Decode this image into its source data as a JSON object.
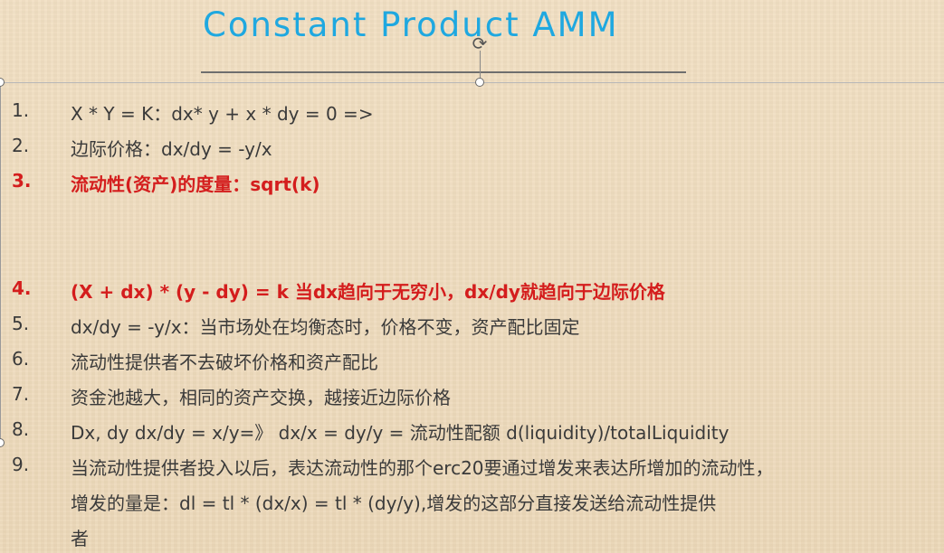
{
  "slide": {
    "title": "Constant Product AMM",
    "items": [
      {
        "num": "1.",
        "text": "X * Y = K：dx* y + x * dy = 0 =>",
        "highlight": false
      },
      {
        "num": "2.",
        "text": "边际价格：dx/dy = -y/x",
        "highlight": false
      },
      {
        "num": "3.",
        "text": "流动性(资产)的度量：sqrt(k)",
        "highlight": true
      },
      {
        "num": "4.",
        "text": "(X + dx) * (y - dy) = k 当dx趋向于无穷小，dx/dy就趋向于边际价格",
        "highlight": true
      },
      {
        "num": "5.",
        "text": "dx/dy = -y/x：当市场处在均衡态时，价格不变，资产配比固定",
        "highlight": false
      },
      {
        "num": "6.",
        "text": "流动性提供者不去破坏价格和资产配比",
        "highlight": false
      },
      {
        "num": "7.",
        "text": "资金池越大，相同的资产交换，越接近边际价格",
        "highlight": false
      },
      {
        "num": "8.",
        "text": "Dx, dy dx/dy = x/y=》 dx/x = dy/y = 流动性配额 d(liquidity)/totalLiquidity",
        "highlight": false
      },
      {
        "num": "9.",
        "text": "当流动性提供者投入以后，表达流动性的那个erc20要通过增发来表达所增加的流动性，",
        "highlight": false
      }
    ],
    "item9_line2": "增发的量是：dl = tl * (dx/x) = tl * (dy/y),增发的这部分直接发送给流动性提供",
    "item9_line3": "者",
    "colors": {
      "title": "#1fa8e0",
      "body_text": "#3a3a3a",
      "highlight_text": "#d41d1d",
      "background": "#efdcbe"
    }
  }
}
